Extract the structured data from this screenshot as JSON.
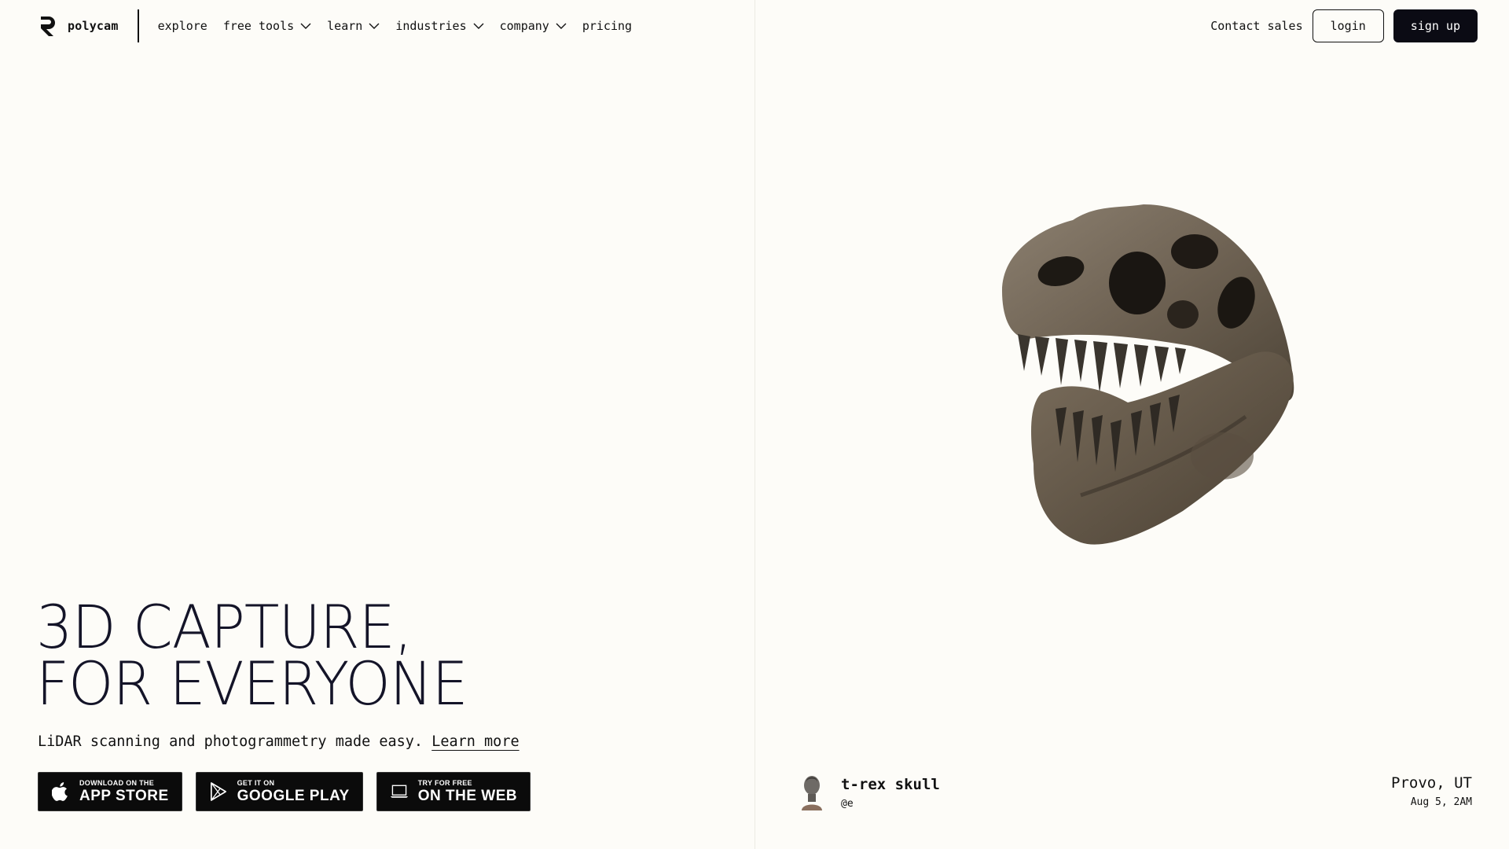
{
  "brand": {
    "name": "polycam",
    "logo_icon": "polycam-logo-icon"
  },
  "nav": {
    "items": [
      {
        "label": "explore",
        "dropdown": false
      },
      {
        "label": "free tools",
        "dropdown": true
      },
      {
        "label": "learn",
        "dropdown": true
      },
      {
        "label": "industries",
        "dropdown": true
      },
      {
        "label": "company",
        "dropdown": true
      },
      {
        "label": "pricing",
        "dropdown": false
      }
    ],
    "contact_label": "Contact sales",
    "login_label": "login",
    "signup_label": "sign up"
  },
  "hero": {
    "title_line1": "3D CAPTURE,",
    "title_line2": "FOR EVERYONE",
    "subtitle": "LiDAR scanning and photogrammetry made easy.",
    "learn_more": "Learn more"
  },
  "stores": [
    {
      "small": "DOWNLOAD ON THE",
      "big": "APP STORE",
      "icon": "apple-icon"
    },
    {
      "small": "GET IT ON",
      "big": "GOOGLE PLAY",
      "icon": "google-play-icon"
    },
    {
      "small": "TRY FOR FREE",
      "big": "ON THE WEB",
      "icon": "laptop-icon"
    }
  ],
  "showcase": {
    "model_title": "t-rex skull",
    "model_user": "@e",
    "location": "Provo, UT",
    "date": "Aug 5, 2AM"
  },
  "colors": {
    "background": "#fdfcf8",
    "text": "#111111",
    "hero_text": "#141428",
    "dark_button": "#0b0b14"
  }
}
